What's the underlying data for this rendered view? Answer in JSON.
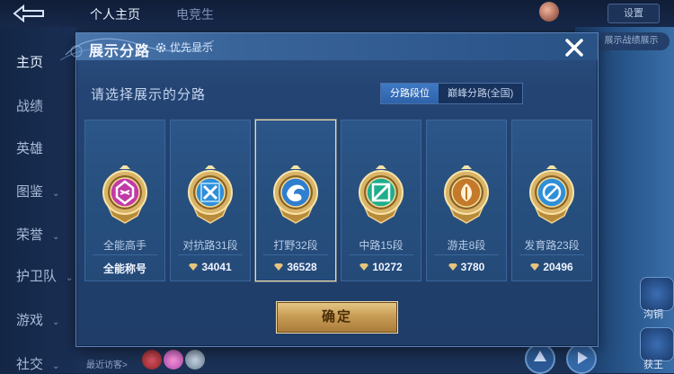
{
  "topbar": {
    "tab_profile": "个人主页",
    "tab_esports": "电竞生",
    "settings_label": "设置"
  },
  "sidebar": {
    "items": [
      {
        "label": "主页",
        "chevron": false
      },
      {
        "label": "战绩",
        "chevron": false
      },
      {
        "label": "英雄",
        "chevron": false
      },
      {
        "label": "图鉴",
        "chevron": true
      },
      {
        "label": "荣誉",
        "chevron": true
      },
      {
        "label": "护卫队",
        "chevron": true
      },
      {
        "label": "游戏",
        "chevron": true
      },
      {
        "label": "社交",
        "chevron": true
      }
    ]
  },
  "right_strip": {
    "pill_label": "展示战绩展示"
  },
  "bottom": {
    "visitors_label": "最近访客>",
    "corner_labels": [
      "沟铜",
      "获王"
    ]
  },
  "modal": {
    "title": "展示分路",
    "priority_label": "优先显示",
    "subtitle": "请选择展示的分路",
    "tabs": [
      {
        "label": "分路段位",
        "selected": true
      },
      {
        "label": "巅峰分路(全国)",
        "selected": false
      }
    ],
    "cards": [
      {
        "name": "全能高手",
        "value": "全能称号",
        "icon": "all-round-emblem-icon",
        "color": "#c23aa8",
        "show_diamond": false,
        "selected": false
      },
      {
        "name": "对抗路31段",
        "value": "34041",
        "icon": "clash-lane-emblem-icon",
        "color": "#2f8fd8",
        "show_diamond": true,
        "selected": false
      },
      {
        "name": "打野32段",
        "value": "36528",
        "icon": "jungle-emblem-icon",
        "color": "#2f7fd0",
        "show_diamond": true,
        "selected": true
      },
      {
        "name": "中路15段",
        "value": "10272",
        "icon": "mid-lane-emblem-icon",
        "color": "#1fae8c",
        "show_diamond": true,
        "selected": false
      },
      {
        "name": "游走8段",
        "value": "3780",
        "icon": "roam-emblem-icon",
        "color": "#c47a2a",
        "show_diamond": true,
        "selected": false
      },
      {
        "name": "发育路23段",
        "value": "20496",
        "icon": "farm-lane-emblem-icon",
        "color": "#2f8fd8",
        "show_diamond": true,
        "selected": false
      }
    ],
    "confirm_label": "确定"
  }
}
